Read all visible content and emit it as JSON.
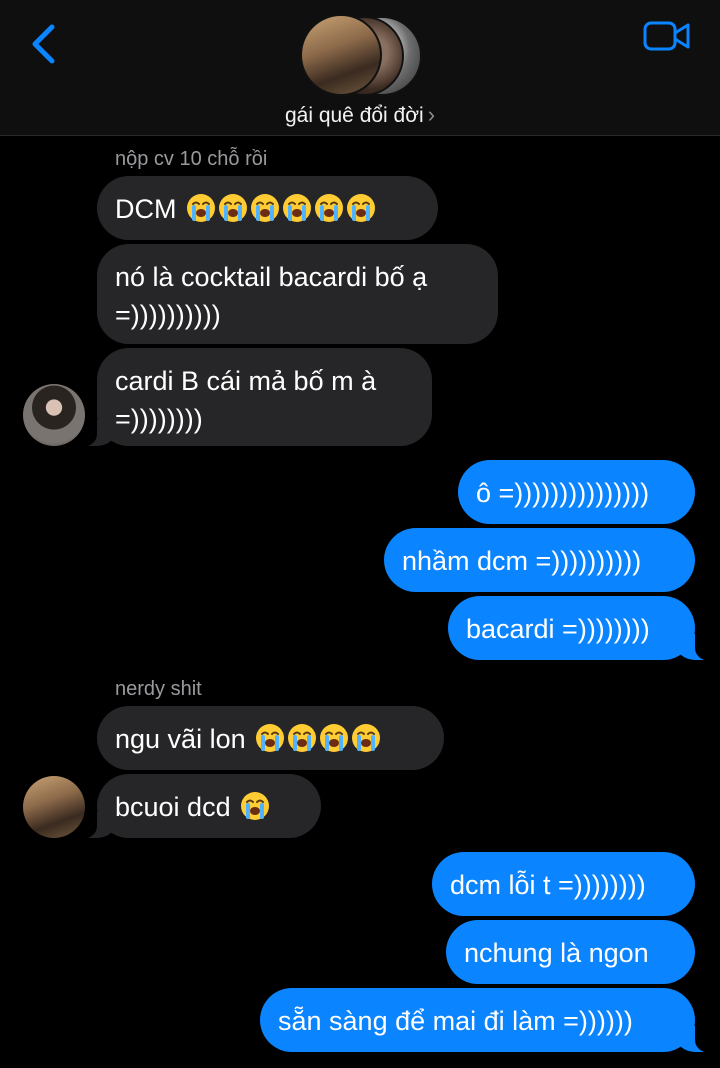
{
  "header": {
    "contact_name": "gái quê đổi đời",
    "chevron": "›",
    "back_icon": "chevron-left-icon",
    "video_icon": "video-camera-icon",
    "accent": "#0a84ff"
  },
  "messages": [
    {
      "sender": "nộp cv 10 chỗ rồi"
    },
    {
      "text": "DCM",
      "emoji_count": 6
    },
    {
      "line1": "nó là cocktail bacardi bố ạ",
      "line2": "=))))))))))"
    },
    {
      "line1": "cardi B cái mả bố m à",
      "line2": "=))))))))"
    },
    {
      "text": "ô =)))))))))))))))"
    },
    {
      "text": "nhầm dcm =))))))))))"
    },
    {
      "text": "bacardi =))))))))"
    },
    {
      "sender": "nerdy shit"
    },
    {
      "text": "ngu vãi lon",
      "emoji_count": 4
    },
    {
      "text": "bcuoi dcd",
      "emoji_count": 1
    },
    {
      "text": "dcm lỗi t =))))))))"
    },
    {
      "text": "nchung là ngon"
    },
    {
      "text": "sẵn sàng để mai đi làm =))))))"
    }
  ],
  "colors": {
    "incoming_bubble": "#262628",
    "outgoing_bubble": "#0a84ff",
    "background": "#000000"
  }
}
